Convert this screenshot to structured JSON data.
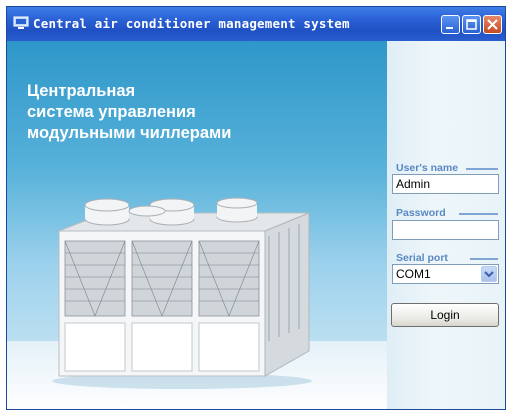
{
  "window": {
    "title": "Central air conditioner management system"
  },
  "hero": {
    "lines": [
      "Центральная",
      "система управления",
      "модульными чиллерами"
    ]
  },
  "form": {
    "username_label": "User's name",
    "username_value": "Admin",
    "password_label": "Password",
    "password_value": "",
    "serial_label": "Serial port",
    "serial_value": "COM1",
    "login_label": "Login"
  }
}
